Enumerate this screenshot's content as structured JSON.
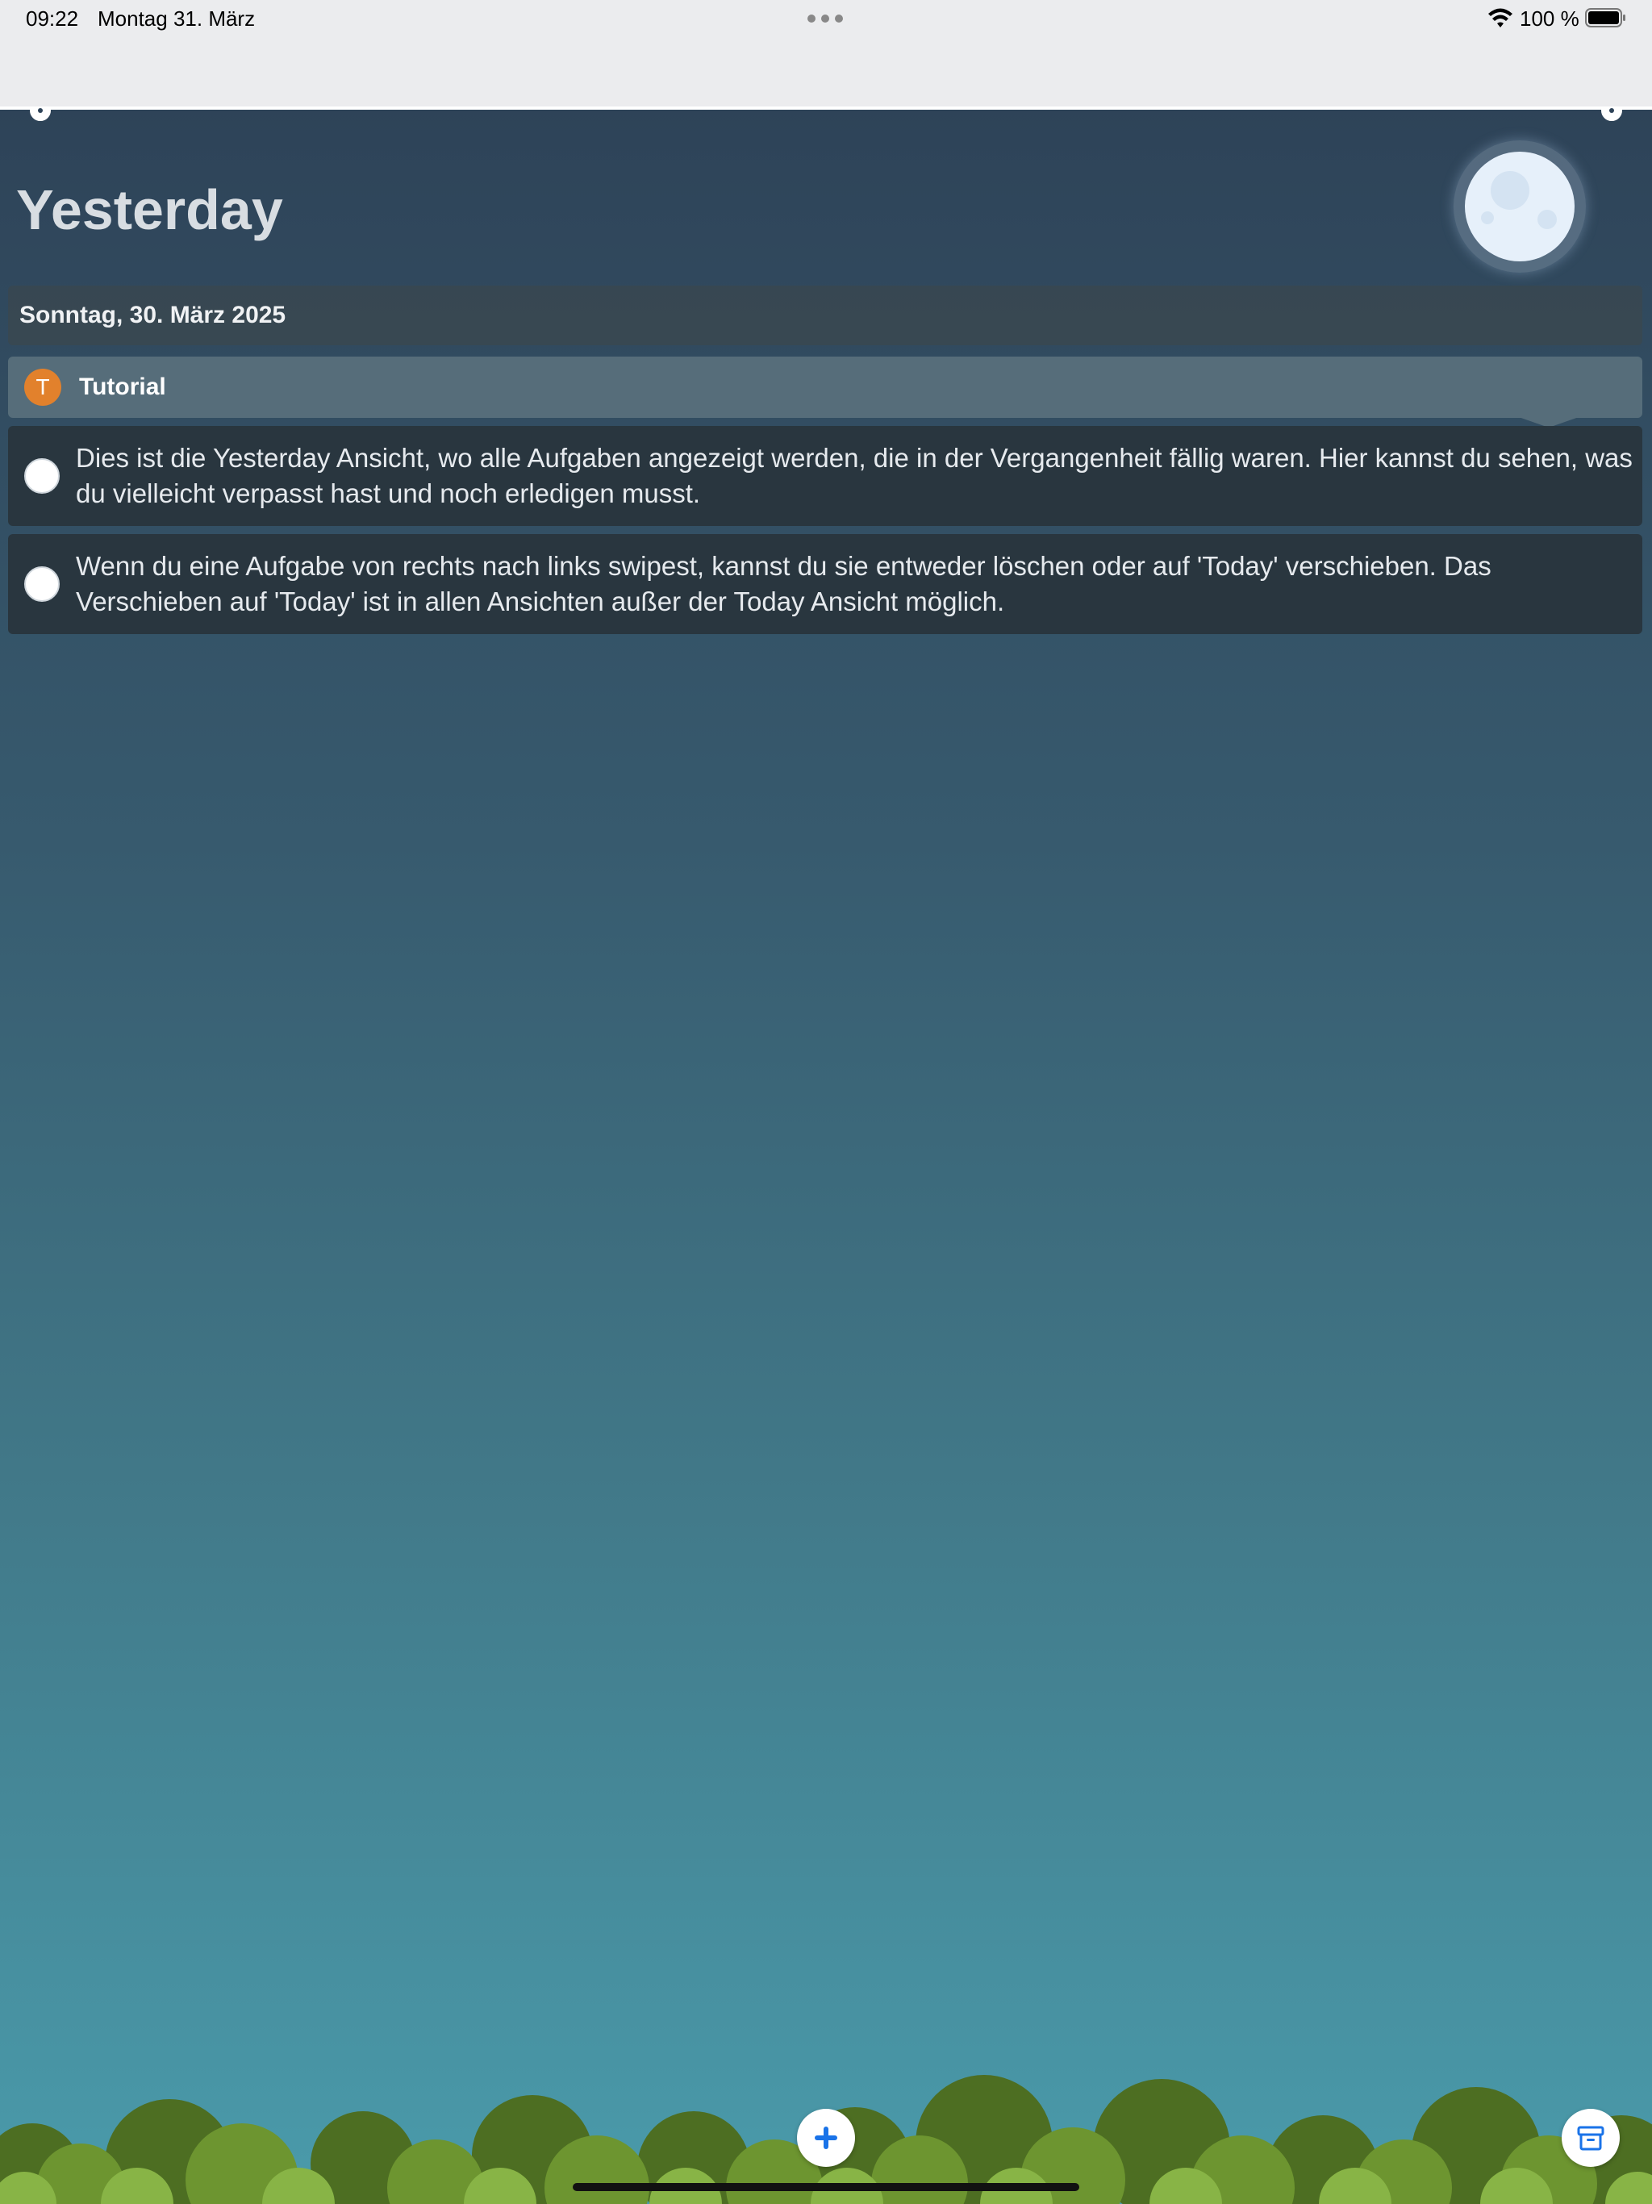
{
  "status_bar": {
    "time": "09:22",
    "date": "Montag 31. März",
    "battery": "100 %"
  },
  "header": {
    "title": "Yesterday"
  },
  "section": {
    "date": "Sonntag, 30. März 2025"
  },
  "category": {
    "initial": "T",
    "label": "Tutorial",
    "color": "#e2812c"
  },
  "tasks": [
    {
      "text": "Dies ist die Yesterday Ansicht, wo alle Aufgaben angezeigt werden, die in der Vergangenheit fällig waren. Hier kannst du sehen, was du vielleicht verpasst hast und noch erledigen musst.",
      "completed": false
    },
    {
      "text": "Wenn du eine Aufgabe von rechts nach links swipest, kannst du sie entweder löschen oder auf 'Today' verschieben. Das Verschieben auf 'Today' ist in allen Ansichten außer der Today Ansicht möglich.",
      "completed": false
    }
  ],
  "toolbar": {
    "add_icon": "plus-icon",
    "archive_icon": "archive-icon",
    "accent": "#1a73e8"
  }
}
